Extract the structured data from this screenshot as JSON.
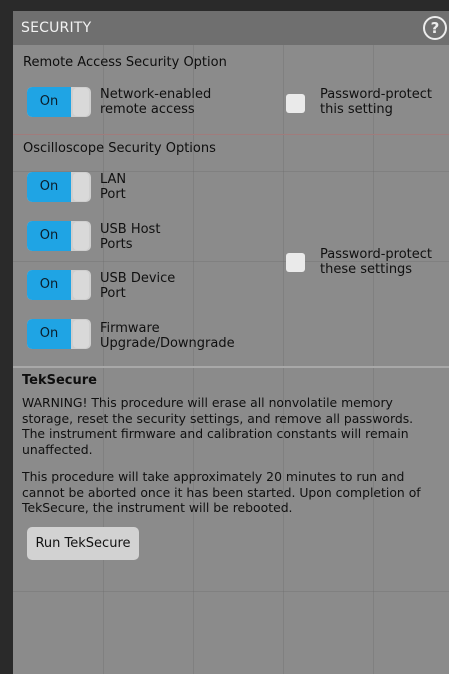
{
  "header": {
    "title": "SECURITY",
    "help_icon": "?"
  },
  "remote_access": {
    "title": "Remote Access Security Option",
    "toggle_label": "On",
    "option_line1": "Network-enabled",
    "option_line2": "remote access",
    "password_line1": "Password-protect",
    "password_line2": "this setting"
  },
  "oscilloscope": {
    "title": "Oscilloscope Security Options",
    "options": [
      {
        "toggle": "On",
        "line1": "LAN",
        "line2": "Port"
      },
      {
        "toggle": "On",
        "line1": "USB Host",
        "line2": "Ports"
      },
      {
        "toggle": "On",
        "line1": "USB Device",
        "line2": "Port"
      },
      {
        "toggle": "On",
        "line1": "Firmware",
        "line2": "Upgrade/Downgrade"
      }
    ],
    "password_line1": "Password-protect",
    "password_line2": "these settings"
  },
  "teksecure": {
    "title": "TekSecure",
    "warning_lines": [
      "WARNING! This procedure will erase all nonvolatile memory",
      "storage, reset the security settings, and remove all passwords.",
      "The instrument firmware and calibration constants will remain",
      "unaffected."
    ],
    "info_lines": [
      "This procedure will take approximately 20 minutes to run and",
      "cannot be aborted once it has been started. Upon completion of",
      "TekSecure, the instrument will be rebooted."
    ],
    "run_button": "Run TekSecure"
  },
  "colors": {
    "panel_bg": "#8b8b8b",
    "titlebar_bg": "#6f6f6f",
    "toggle_on": "#1fa4e4"
  }
}
